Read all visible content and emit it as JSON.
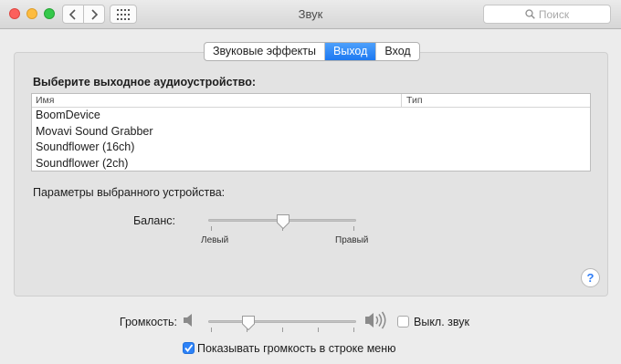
{
  "window": {
    "title": "Звук"
  },
  "search": {
    "placeholder": "Поиск"
  },
  "tabs": [
    {
      "label": "Звуковые эффекты",
      "active": false
    },
    {
      "label": "Выход",
      "active": true
    },
    {
      "label": "Вход",
      "active": false
    }
  ],
  "output": {
    "heading": "Выберите выходное аудиоустройство:",
    "columns": [
      "Имя",
      "Тип"
    ],
    "devices": [
      "BoomDevice",
      "Movavi Sound Grabber",
      "Soundflower (16ch)",
      "Soundflower (2ch)"
    ],
    "params_label": "Параметры выбранного устройства:",
    "balance": {
      "label": "Баланс:",
      "left": "Левый",
      "right": "Правый",
      "value": 0.5
    }
  },
  "volume": {
    "label": "Громкость:",
    "value": 0.27,
    "mute_label": "Выкл. звук",
    "muted": false
  },
  "menu_bar_checkbox": {
    "label": "Показывать громкость в строке меню",
    "checked": true
  },
  "colors": {
    "accent": "#1d79f2",
    "tab_active": "#2f8af8",
    "close": "#fc605c",
    "minimize": "#fdbc40",
    "zoom": "#34c84a"
  }
}
